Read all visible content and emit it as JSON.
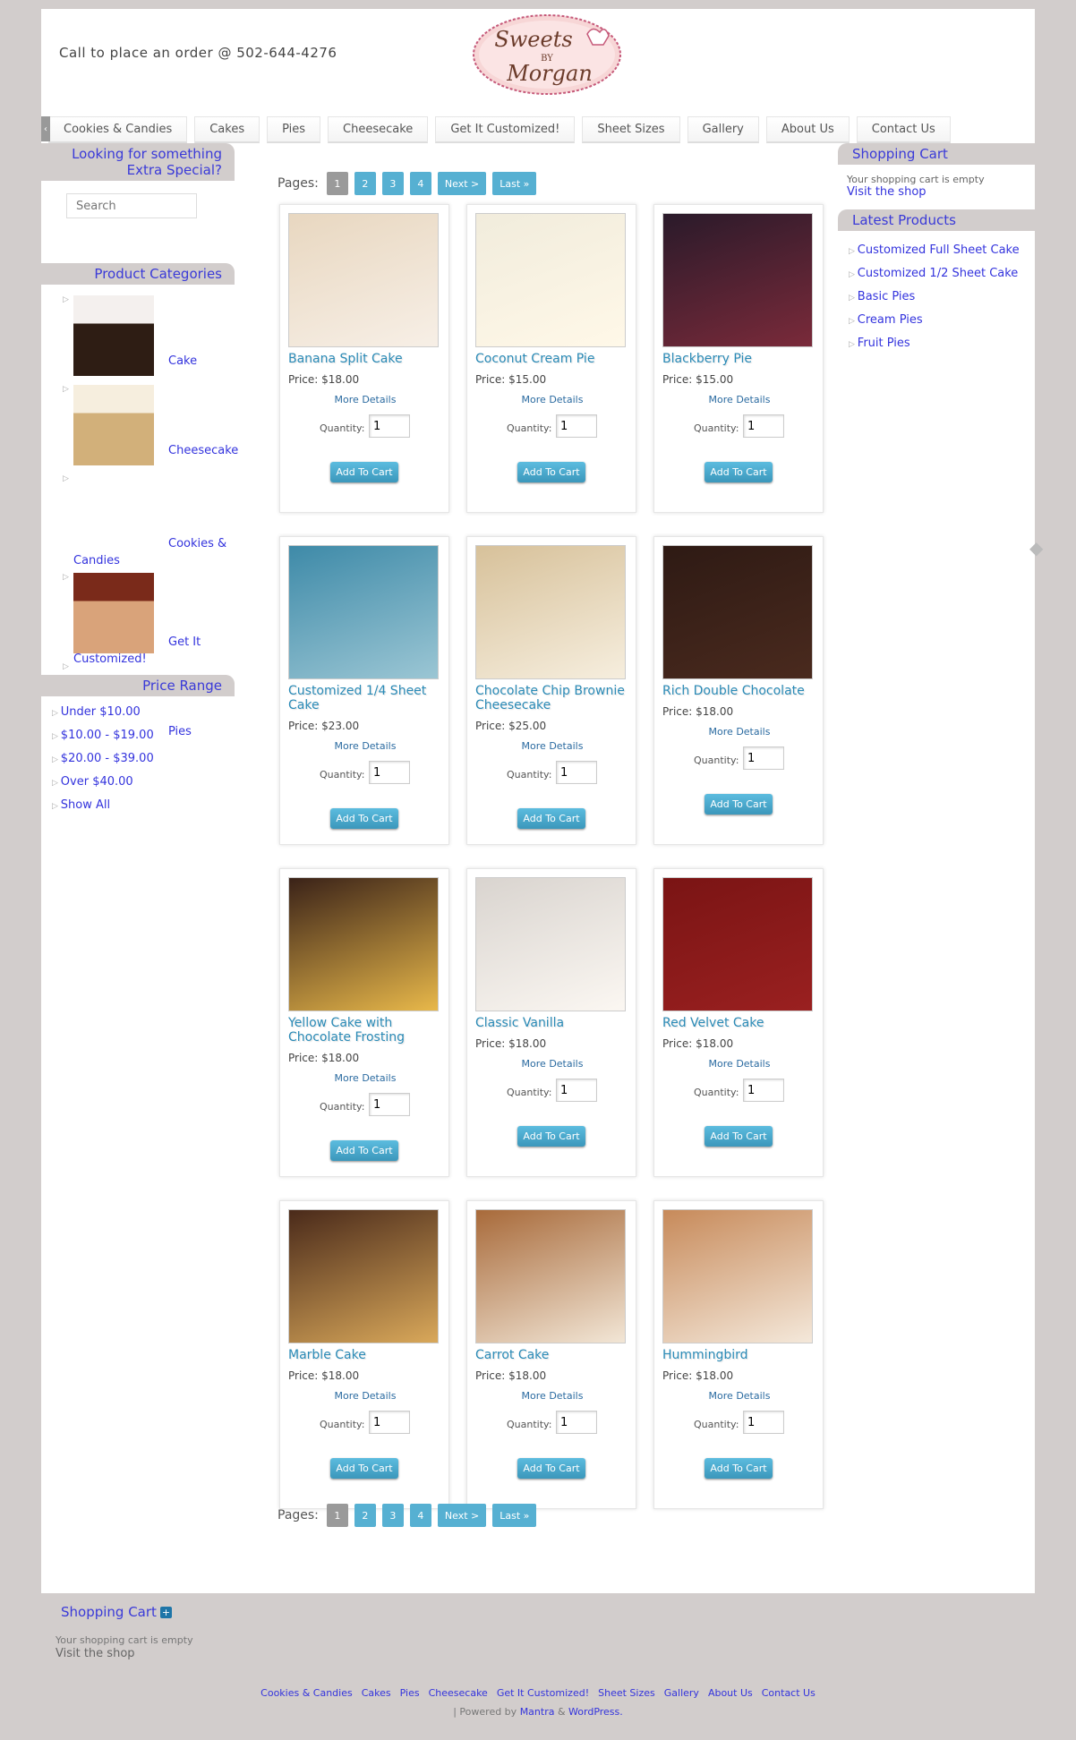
{
  "header": {
    "phone_text": "Call to place an order @ 502-644-4276",
    "logo_line1": "Sweets",
    "logo_line2": "BY",
    "logo_line3": "Morgan"
  },
  "menu": [
    "Cookies & Candies",
    "Cakes",
    "Pies",
    "Cheesecake",
    "Get It Customized!",
    "Sheet Sizes",
    "Gallery",
    "About Us",
    "Contact Us"
  ],
  "left": {
    "special_title": "Looking for something Extra Special?",
    "search_placeholder": "Search",
    "categories_title": "Product Categories",
    "categories": [
      "Cake",
      "Cheesecake",
      "Cookies & Candies",
      "Get It Customized!",
      "Pies"
    ],
    "price_title": "Price Range",
    "price_ranges": [
      "Under $10.00",
      "$10.00 - $19.00",
      "$20.00 - $39.00",
      "Over $40.00",
      "Show All"
    ]
  },
  "pager": {
    "label": "Pages:",
    "pages": [
      "1",
      "2",
      "3",
      "4"
    ],
    "next": "Next >",
    "last": "Last »"
  },
  "card_labels": {
    "more": "More Details",
    "qty_label": "Quantity:",
    "qty_value": "1",
    "add": "Add To Cart"
  },
  "products": [
    {
      "name": "Banana Split Cake",
      "price": "Price: $18.00"
    },
    {
      "name": "Coconut Cream Pie",
      "price": "Price: $15.00"
    },
    {
      "name": "Blackberry Pie",
      "price": "Price: $15.00"
    },
    {
      "name": "Customized 1/4 Sheet Cake",
      "price": "Price: $23.00"
    },
    {
      "name": "Chocolate Chip Brownie Cheesecake",
      "price": "Price: $25.00"
    },
    {
      "name": "Rich Double Chocolate",
      "price": "Price: $18.00"
    },
    {
      "name": "Yellow Cake with Chocolate Frosting",
      "price": "Price: $18.00"
    },
    {
      "name": "Classic Vanilla",
      "price": "Price: $18.00"
    },
    {
      "name": "Red Velvet Cake",
      "price": "Price: $18.00"
    },
    {
      "name": "Marble Cake",
      "price": "Price: $18.00"
    },
    {
      "name": "Carrot Cake",
      "price": "Price: $18.00"
    },
    {
      "name": "Hummingbird",
      "price": "Price: $18.00"
    }
  ],
  "right": {
    "cart_title": "Shopping Cart",
    "cart_empty": "Your shopping cart is empty",
    "cart_link": "Visit the shop",
    "latest_title": "Latest Products",
    "latest": [
      "Customized Full Sheet Cake",
      "Customized 1/2 Sheet Cake",
      "Basic Pies",
      "Cream Pies",
      "Fruit Pies"
    ]
  },
  "footer": {
    "cart_title": "Shopping Cart",
    "cart_empty": "Your shopping cart is empty",
    "cart_link": "Visit the shop",
    "nav": [
      "Cookies & Candies",
      "Cakes",
      "Pies",
      "Cheesecake",
      "Get It Customized!",
      "Sheet Sizes",
      "Gallery",
      "About Us",
      "Contact Us"
    ],
    "powered_prefix": "| Powered by",
    "powered_mantra": "Mantra",
    "powered_and": "&",
    "powered_wp": "WordPress."
  },
  "colors": {
    "accent_link": "#3333dd",
    "product_title": "#2a8ab6",
    "button": "#56b0d2",
    "page_bg": "#d2cdcc"
  }
}
